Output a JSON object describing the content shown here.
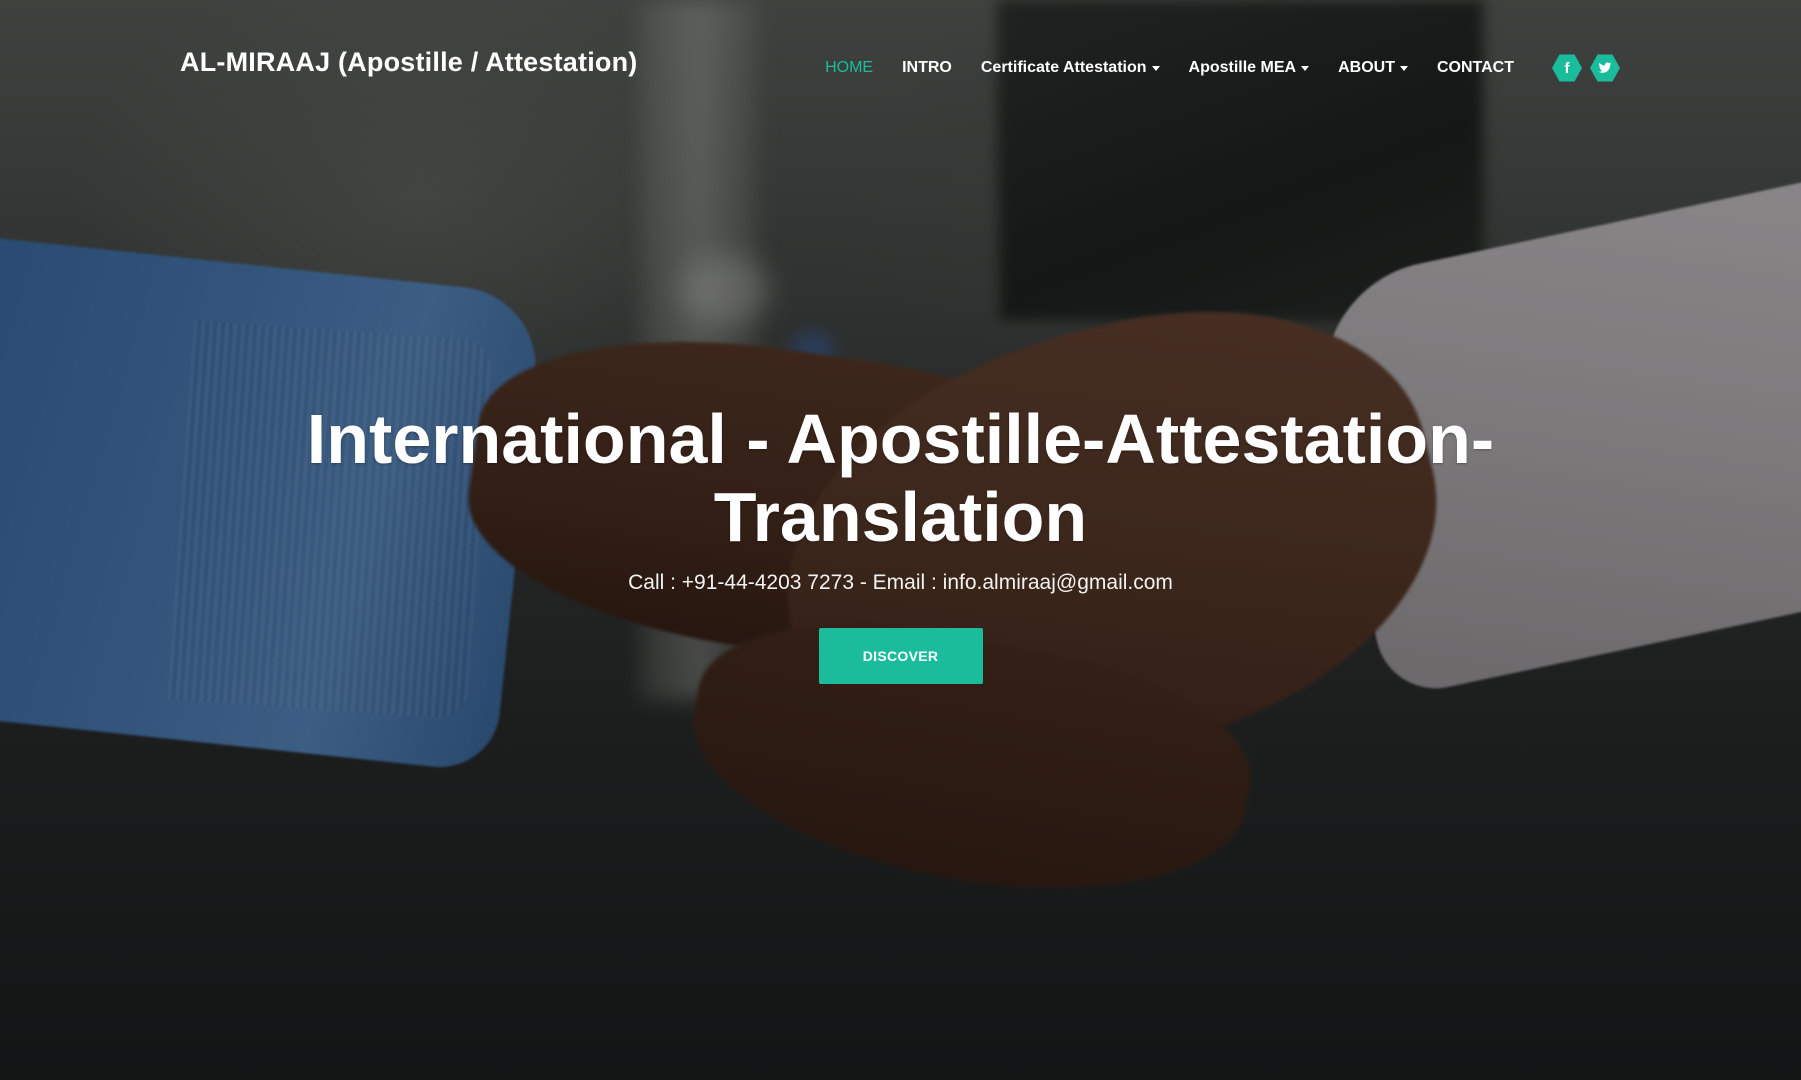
{
  "brand": {
    "title": "AL-MIRAAJ (Apostille / Attestation)"
  },
  "nav": {
    "items": [
      {
        "label": "HOME",
        "active": true,
        "dropdown": false
      },
      {
        "label": "INTRO",
        "active": false,
        "dropdown": false
      },
      {
        "label": "Certificate Attestation",
        "active": false,
        "dropdown": true
      },
      {
        "label": "Apostille MEA",
        "active": false,
        "dropdown": true
      },
      {
        "label": "ABOUT",
        "active": false,
        "dropdown": true
      },
      {
        "label": "CONTACT",
        "active": false,
        "dropdown": false
      }
    ],
    "social": [
      {
        "icon": "facebook-icon",
        "glyph": "f"
      },
      {
        "icon": "twitter-icon",
        "glyph": ""
      }
    ]
  },
  "hero": {
    "title": "International - Apostille-Attestation-Translation",
    "subtitle": "Call : +91-44-4203 7273 - Email : info.almiraaj@gmail.com",
    "cta": "DISCOVER"
  },
  "colors": {
    "accent": "#1abc9c",
    "text": "#ffffff"
  }
}
